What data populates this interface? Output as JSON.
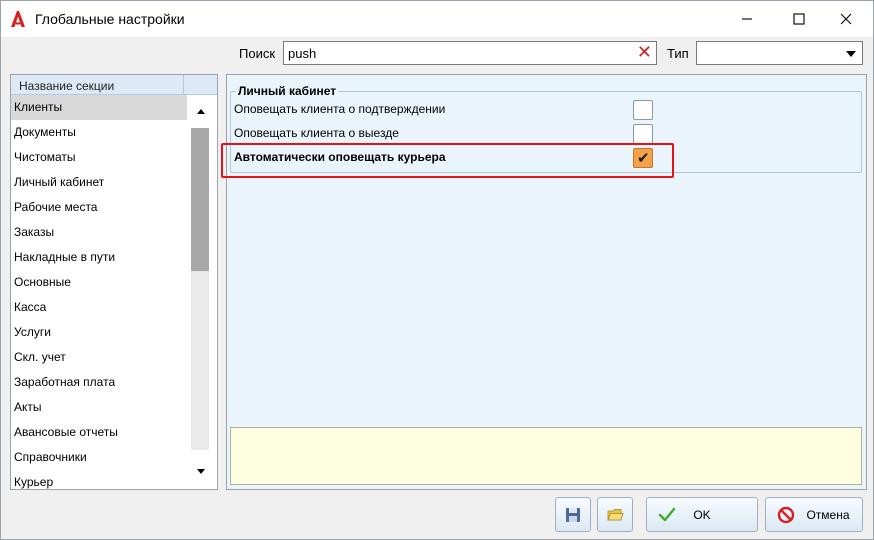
{
  "window": {
    "title": "Глобальные настройки",
    "colors": {
      "accent_red": "#e3121b",
      "panel_bg": "#e9f5fb",
      "checked_orange": "#f4a24a",
      "description_bg": "#fdfde0"
    }
  },
  "search": {
    "label": "Поиск",
    "value": "push",
    "type_label": "Тип",
    "type_value": ""
  },
  "sections": {
    "header": "Название секции",
    "items": [
      "Клиенты",
      "Документы",
      "Чистоматы",
      "Личный кабинет",
      "Рабочие места",
      "Заказы",
      "Накладные в пути",
      "Основные",
      "Касса",
      "Услуги",
      "Скл. учет",
      "Заработная плата",
      "Акты",
      "Авансовые отчеты",
      "Справочники",
      "Курьер"
    ],
    "selected": "Клиенты"
  },
  "settings": {
    "group_title": "Личный кабинет",
    "rows": [
      {
        "label": "Оповещать клиента о подтверждении",
        "checked": false
      },
      {
        "label": "Оповещать клиента о выезде",
        "checked": false
      },
      {
        "label": "Автоматически оповещать курьера",
        "checked": true
      }
    ],
    "description": ""
  },
  "buttons": {
    "save_icon": "floppy-disk-icon",
    "open_icon": "folder-icon",
    "ok_label": "OK",
    "cancel_label": "Отмена"
  }
}
